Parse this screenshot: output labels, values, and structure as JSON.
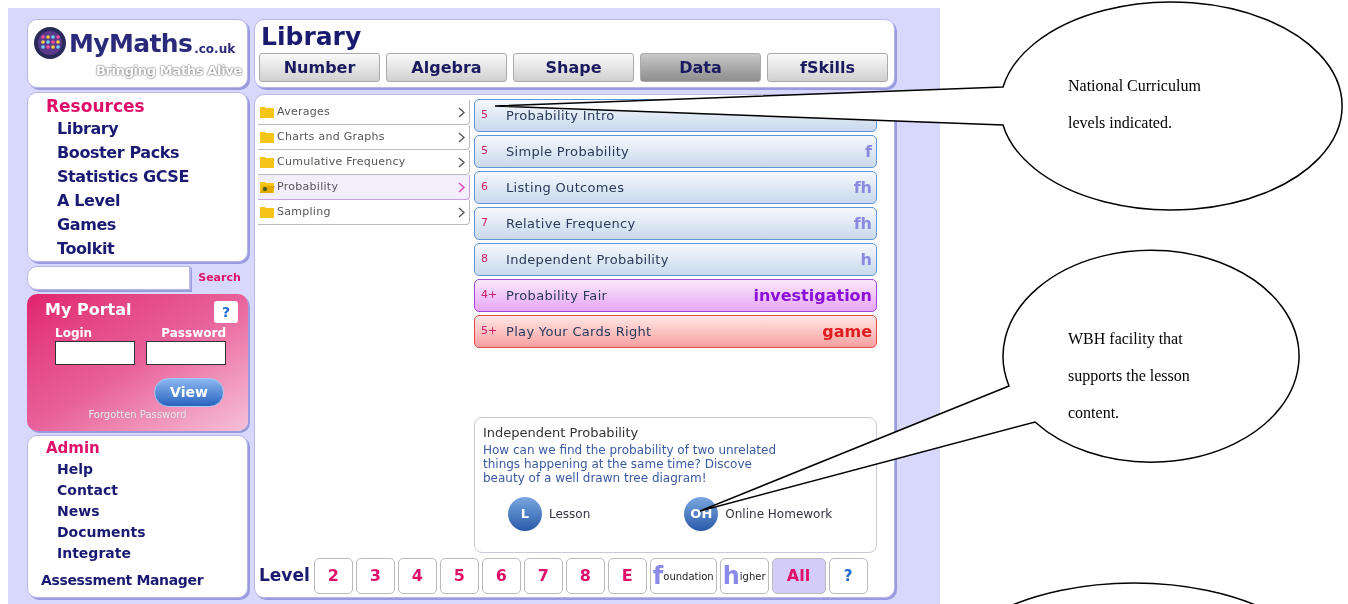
{
  "logo": {
    "name": "MyMaths",
    "suffix": ".co.uk",
    "tagline": "Bringing Maths Alive"
  },
  "header": {
    "title": "Library",
    "tabs": [
      {
        "label": "Number",
        "selected": false
      },
      {
        "label": "Algebra",
        "selected": false
      },
      {
        "label": "Shape",
        "selected": false
      },
      {
        "label": "Data",
        "selected": true
      },
      {
        "label": "fSkills",
        "selected": false
      }
    ]
  },
  "resources": {
    "heading": "Resources",
    "items": [
      "Library",
      "Booster Packs",
      "Statistics GCSE",
      "A Level",
      "Games",
      "Toolkit"
    ]
  },
  "search": {
    "button": "Search"
  },
  "portal": {
    "title": "My Portal",
    "help": "?",
    "login_label": "Login",
    "password_label": "Password",
    "button": "View",
    "link": "Forgotten Password"
  },
  "admin": {
    "heading": "Admin",
    "items": [
      "Help",
      "Contact",
      "News",
      "Documents",
      "Integrate"
    ],
    "footer_link": "Assessment Manager"
  },
  "topics": [
    {
      "label": "Averages",
      "selected": false
    },
    {
      "label": "Charts and Graphs",
      "selected": false
    },
    {
      "label": "Cumulative Frequency",
      "selected": false
    },
    {
      "label": "Probability",
      "selected": true
    },
    {
      "label": "Sampling",
      "selected": false
    }
  ],
  "lessons": [
    {
      "level": "5",
      "title": "Probability Intro",
      "kind": "lesson"
    },
    {
      "level": "5",
      "title": "Simple Probability",
      "tag": "f",
      "kind": "lesson"
    },
    {
      "level": "6",
      "title": "Listing Outcomes",
      "tag": "fh",
      "kind": "lesson"
    },
    {
      "level": "7",
      "title": "Relative Frequency",
      "tag": "fh",
      "kind": "lesson"
    },
    {
      "level": "8",
      "title": "Independent Probability",
      "tag": "h",
      "kind": "lesson"
    },
    {
      "level": "4+",
      "title": "Probability Fair",
      "tag": "investigation",
      "kind": "investigation"
    },
    {
      "level": "5+",
      "title": "Play Your Cards Right",
      "tag": "game",
      "kind": "game"
    }
  ],
  "info": {
    "title": "Independent Probability",
    "lines": [
      "How can we find the probability of two unrelated",
      "things happening at the same time? Discove",
      "beauty of a well drawn tree diagram!"
    ],
    "actions": [
      {
        "badge": "L",
        "label": "Lesson"
      },
      {
        "badge": "OH",
        "label": "Online Homework"
      }
    ]
  },
  "level_bar": {
    "label": "Level",
    "buttons": [
      {
        "kind": "plain",
        "label": "2",
        "selected": false
      },
      {
        "kind": "plain",
        "label": "3",
        "selected": false
      },
      {
        "kind": "plain",
        "label": "4",
        "selected": false
      },
      {
        "kind": "plain",
        "label": "5",
        "selected": false
      },
      {
        "kind": "plain",
        "label": "6",
        "selected": false
      },
      {
        "kind": "plain",
        "label": "7",
        "selected": false
      },
      {
        "kind": "plain",
        "label": "8",
        "selected": false
      },
      {
        "kind": "plain",
        "label": "E",
        "selected": false
      },
      {
        "kind": "initial",
        "initial": "f",
        "label": "oundation",
        "selected": false
      },
      {
        "kind": "initial",
        "initial": "h",
        "label": "igher",
        "selected": false
      },
      {
        "kind": "plain",
        "label": "All",
        "selected": true
      },
      {
        "kind": "help",
        "label": "?",
        "selected": false
      }
    ]
  },
  "callouts": [
    {
      "lines": [
        "National Curriculum",
        "levels indicated."
      ]
    },
    {
      "lines": [
        "WBH facility that",
        "supports the lesson",
        "content."
      ]
    }
  ]
}
